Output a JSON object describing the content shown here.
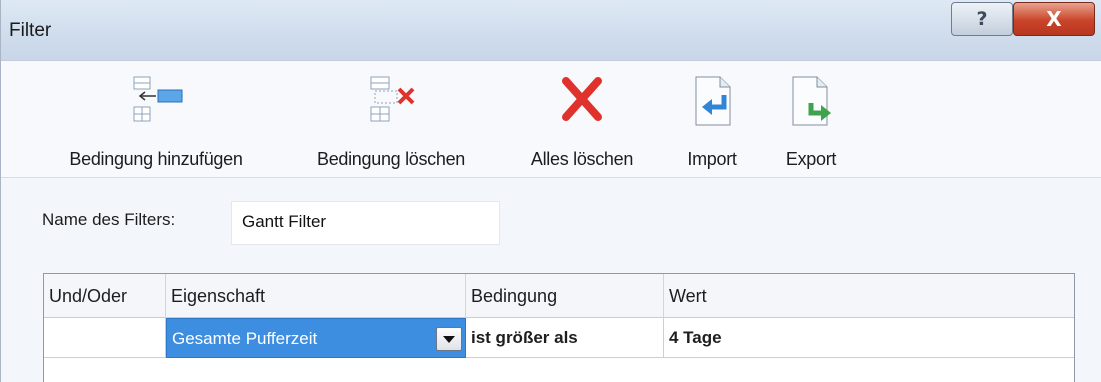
{
  "window": {
    "title": "Filter",
    "help_label": "?",
    "close_label": "X"
  },
  "toolbar": {
    "items": [
      {
        "label": "Bedingung hinzufügen",
        "icon": "add-condition-icon"
      },
      {
        "label": "Bedingung löschen",
        "icon": "delete-condition-icon"
      },
      {
        "label": "Alles löschen",
        "icon": "delete-all-icon"
      },
      {
        "label": "Import",
        "icon": "import-icon"
      },
      {
        "label": "Export",
        "icon": "export-icon"
      }
    ]
  },
  "filter_name": {
    "label": "Name des Filters:",
    "value": "Gantt Filter"
  },
  "grid": {
    "columns": [
      "Und/Oder",
      "Eigenschaft",
      "Bedingung",
      "Wert"
    ],
    "rows": [
      {
        "und_oder": "",
        "eigenschaft": "Gesamte Pufferzeit",
        "bedingung": "ist größer als",
        "wert": "4 Tage"
      }
    ]
  },
  "colors": {
    "selection": "#3d8ee0",
    "delete_red": "#e0322c",
    "arrow_blue": "#2f86d6",
    "arrow_green": "#3fa34d"
  }
}
